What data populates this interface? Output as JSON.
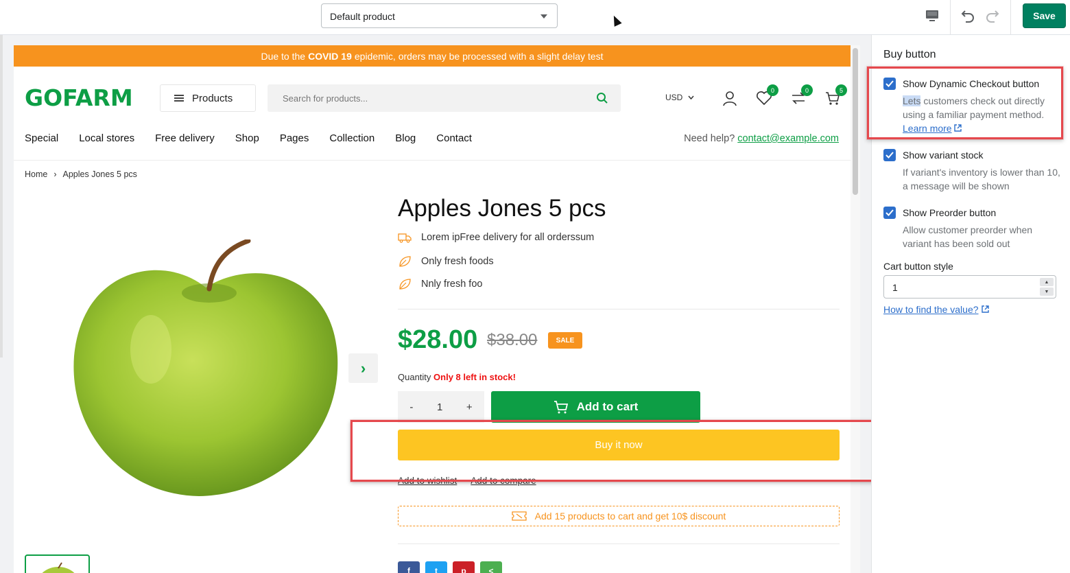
{
  "editor": {
    "template_value": "Default product",
    "save_label": "Save"
  },
  "store": {
    "announcement_pre": "Due to the",
    "announcement_bold": "COVID 19",
    "announcement_post": "epidemic, orders may be processed with a slight delay test",
    "logo": "GOFARM",
    "products_menu": "Products",
    "search_placeholder": "Search for products...",
    "currency": "USD",
    "wishlist_count": "0",
    "compare_count": "0",
    "cart_count": "5",
    "nav": [
      "Special",
      "Local stores",
      "Free delivery",
      "Shop",
      "Pages",
      "Collection",
      "Blog",
      "Contact"
    ],
    "help_label": "Need help?",
    "help_email": "contact@example.com"
  },
  "breadcrumb": {
    "home": "Home",
    "separator": "›",
    "current": "Apples Jones 5 pcs"
  },
  "product": {
    "title": "Apples Jones 5 pcs",
    "features": [
      "Lorem ipFree delivery for all orderssum",
      "Only fresh foods",
      "Nnly fresh foo"
    ],
    "price": "$28.00",
    "compare_price": "$38.00",
    "sale_badge": "SALE",
    "quantity_label": "Quantity",
    "stock_text": "Only 8 left in stock!",
    "qty_minus": "-",
    "quantity": "1",
    "qty_plus": "+",
    "add_to_cart": "Add to cart",
    "buy_now": "Buy it now",
    "add_to_wishlist": "Add to wishlist",
    "add_to_compare": "Add to compare",
    "discount_text": "Add 15 products to cart and get 10$ discount",
    "next_arrow": "›"
  },
  "panel": {
    "title": "Buy button",
    "settings": [
      {
        "label": "Show Dynamic Checkout button",
        "help_highlight": "Lets",
        "help": " customers check out directly using a familiar payment method.",
        "link": "Learn more",
        "checked": true
      },
      {
        "label": "Show variant stock",
        "help": "If variant's inventory is lower than 10, a message will be shown",
        "checked": true
      },
      {
        "label": "Show Preorder button",
        "help": "Allow customer preorder when variant has been sold out",
        "checked": true
      }
    ],
    "cart_style_label": "Cart button style",
    "cart_style_value": "1",
    "find_value_link": "How to find the value?"
  },
  "colors": {
    "brand_green": "#0d9e45",
    "announcement_orange": "#f7931e",
    "buy_now_yellow": "#fdc522",
    "save_green": "#008060",
    "checkbox_blue": "#2c6ecb",
    "highlight_red": "#e5484d"
  }
}
